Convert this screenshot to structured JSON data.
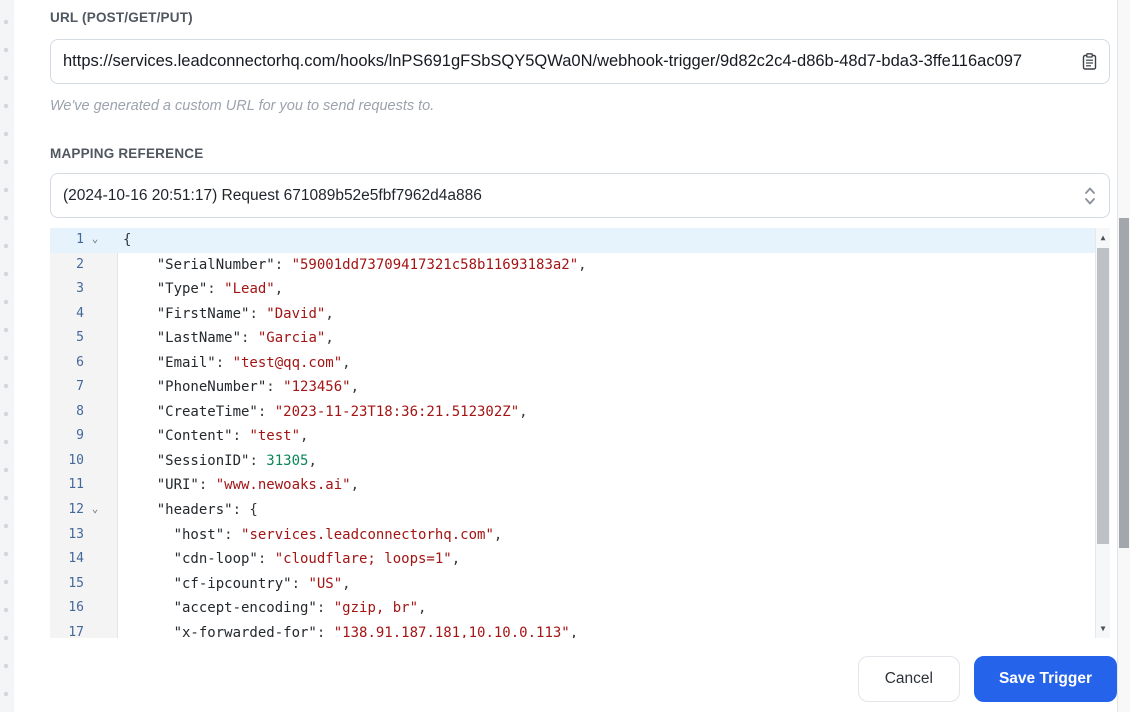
{
  "url_section": {
    "label": "URL (POST/GET/PUT)",
    "value": "https://services.leadconnectorhq.com/hooks/lnPS691gFSbSQY5QWa0N/webhook-trigger/9d82c2c4-d86b-48d7-bda3-3ffe116ac097",
    "helper": "We've generated a custom URL for you to send requests to."
  },
  "mapping_section": {
    "label": "MAPPING REFERENCE",
    "selected_option": "(2024-10-16 20:51:17) Request 671089b52e5fbf7962d4a886"
  },
  "editor": {
    "lines": [
      {
        "num": 1,
        "fold": true,
        "active": true,
        "tokens": [
          [
            "p",
            "{"
          ]
        ]
      },
      {
        "num": 2,
        "tokens": [
          [
            "k",
            "    \"SerialNumber\""
          ],
          [
            "p",
            ": "
          ],
          [
            "s",
            "\"59001dd73709417321c58b11693183a2\""
          ],
          [
            "p",
            ","
          ]
        ]
      },
      {
        "num": 3,
        "tokens": [
          [
            "k",
            "    \"Type\""
          ],
          [
            "p",
            ": "
          ],
          [
            "s",
            "\"Lead\""
          ],
          [
            "p",
            ","
          ]
        ]
      },
      {
        "num": 4,
        "tokens": [
          [
            "k",
            "    \"FirstName\""
          ],
          [
            "p",
            ": "
          ],
          [
            "s",
            "\"David\""
          ],
          [
            "p",
            ","
          ]
        ]
      },
      {
        "num": 5,
        "tokens": [
          [
            "k",
            "    \"LastName\""
          ],
          [
            "p",
            ": "
          ],
          [
            "s",
            "\"Garcia\""
          ],
          [
            "p",
            ","
          ]
        ]
      },
      {
        "num": 6,
        "tokens": [
          [
            "k",
            "    \"Email\""
          ],
          [
            "p",
            ": "
          ],
          [
            "s",
            "\"test@qq.com\""
          ],
          [
            "p",
            ","
          ]
        ]
      },
      {
        "num": 7,
        "tokens": [
          [
            "k",
            "    \"PhoneNumber\""
          ],
          [
            "p",
            ": "
          ],
          [
            "s",
            "\"123456\""
          ],
          [
            "p",
            ","
          ]
        ]
      },
      {
        "num": 8,
        "tokens": [
          [
            "k",
            "    \"CreateTime\""
          ],
          [
            "p",
            ": "
          ],
          [
            "s",
            "\"2023-11-23T18:36:21.512302Z\""
          ],
          [
            "p",
            ","
          ]
        ]
      },
      {
        "num": 9,
        "tokens": [
          [
            "k",
            "    \"Content\""
          ],
          [
            "p",
            ": "
          ],
          [
            "s",
            "\"test\""
          ],
          [
            "p",
            ","
          ]
        ]
      },
      {
        "num": 10,
        "tokens": [
          [
            "k",
            "    \"SessionID\""
          ],
          [
            "p",
            ": "
          ],
          [
            "n",
            "31305"
          ],
          [
            "p",
            ","
          ]
        ]
      },
      {
        "num": 11,
        "tokens": [
          [
            "k",
            "    \"URI\""
          ],
          [
            "p",
            ": "
          ],
          [
            "s",
            "\"www.newoaks.ai\""
          ],
          [
            "p",
            ","
          ]
        ]
      },
      {
        "num": 12,
        "fold": true,
        "tokens": [
          [
            "k",
            "    \"headers\""
          ],
          [
            "p",
            ": {"
          ]
        ]
      },
      {
        "num": 13,
        "tokens": [
          [
            "k",
            "      \"host\""
          ],
          [
            "p",
            ": "
          ],
          [
            "s",
            "\"services.leadconnectorhq.com\""
          ],
          [
            "p",
            ","
          ]
        ]
      },
      {
        "num": 14,
        "tokens": [
          [
            "k",
            "      \"cdn-loop\""
          ],
          [
            "p",
            ": "
          ],
          [
            "s",
            "\"cloudflare; loops=1\""
          ],
          [
            "p",
            ","
          ]
        ]
      },
      {
        "num": 15,
        "tokens": [
          [
            "k",
            "      \"cf-ipcountry\""
          ],
          [
            "p",
            ": "
          ],
          [
            "s",
            "\"US\""
          ],
          [
            "p",
            ","
          ]
        ]
      },
      {
        "num": 16,
        "tokens": [
          [
            "k",
            "      \"accept-encoding\""
          ],
          [
            "p",
            ": "
          ],
          [
            "s",
            "\"gzip, br\""
          ],
          [
            "p",
            ","
          ]
        ]
      },
      {
        "num": 17,
        "tokens": [
          [
            "k",
            "      \"x-forwarded-for\""
          ],
          [
            "p",
            ": "
          ],
          [
            "s",
            "\"138.91.187.181,10.10.0.113\""
          ],
          [
            "p",
            ","
          ]
        ]
      }
    ]
  },
  "footer": {
    "cancel_label": "Cancel",
    "save_label": "Save Trigger"
  },
  "icons": {
    "copy": "clipboard-copy-icon",
    "select": "up-down-chevrons-icon",
    "fold": "fold-collapse-chevron"
  },
  "colors": {
    "accent_blue": "#2563eb",
    "syntax_string": "#a31515",
    "syntax_number": "#098658",
    "active_line_bg": "#e6f3fc",
    "line_number": "#44689a"
  }
}
